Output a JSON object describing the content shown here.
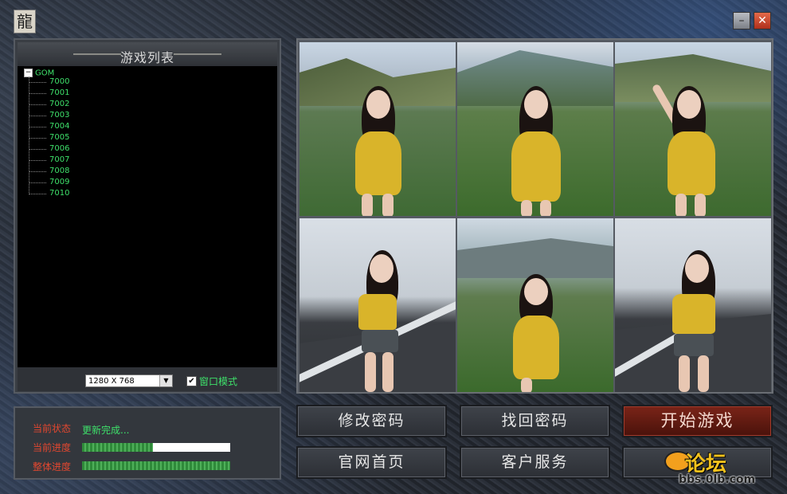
{
  "window": {
    "logo_char": "龍",
    "minimize_glyph": "–",
    "close_glyph": "✕",
    "colors": {
      "accent_red": "#b0301c",
      "list_text": "#3ee06a",
      "status_label": "#e2472f"
    }
  },
  "game_list": {
    "title": "游戏列表",
    "root": {
      "expander": "−",
      "label": "GOM"
    },
    "items": [
      "7000",
      "7001",
      "7002",
      "7003",
      "7004",
      "7005",
      "7006",
      "7007",
      "7008",
      "7009",
      "7010"
    ]
  },
  "display": {
    "resolution": "1280 X 768",
    "dropdown_arrow": "▼",
    "window_mode_checked": "✔",
    "window_mode_label": "窗口模式"
  },
  "status": {
    "state_label": "当前状态",
    "state_value": "更新完成...",
    "current_progress_label": "当前进度",
    "current_progress": 0.48,
    "overall_progress_label": "整体进度",
    "overall_progress": 1.0
  },
  "buttons": {
    "change_password": "修改密码",
    "recover_password": "找回密码",
    "start_game": "开始游戏",
    "official_site": "官网首页",
    "customer_service": "客户服务"
  },
  "watermark": {
    "text": "论坛",
    "url": "bbs.0lb.com"
  },
  "icons": [
    "dragon-logo-icon",
    "minimize-icon",
    "close-icon",
    "tree-expander-icon",
    "dropdown-arrow-icon",
    "checkbox-icon"
  ]
}
